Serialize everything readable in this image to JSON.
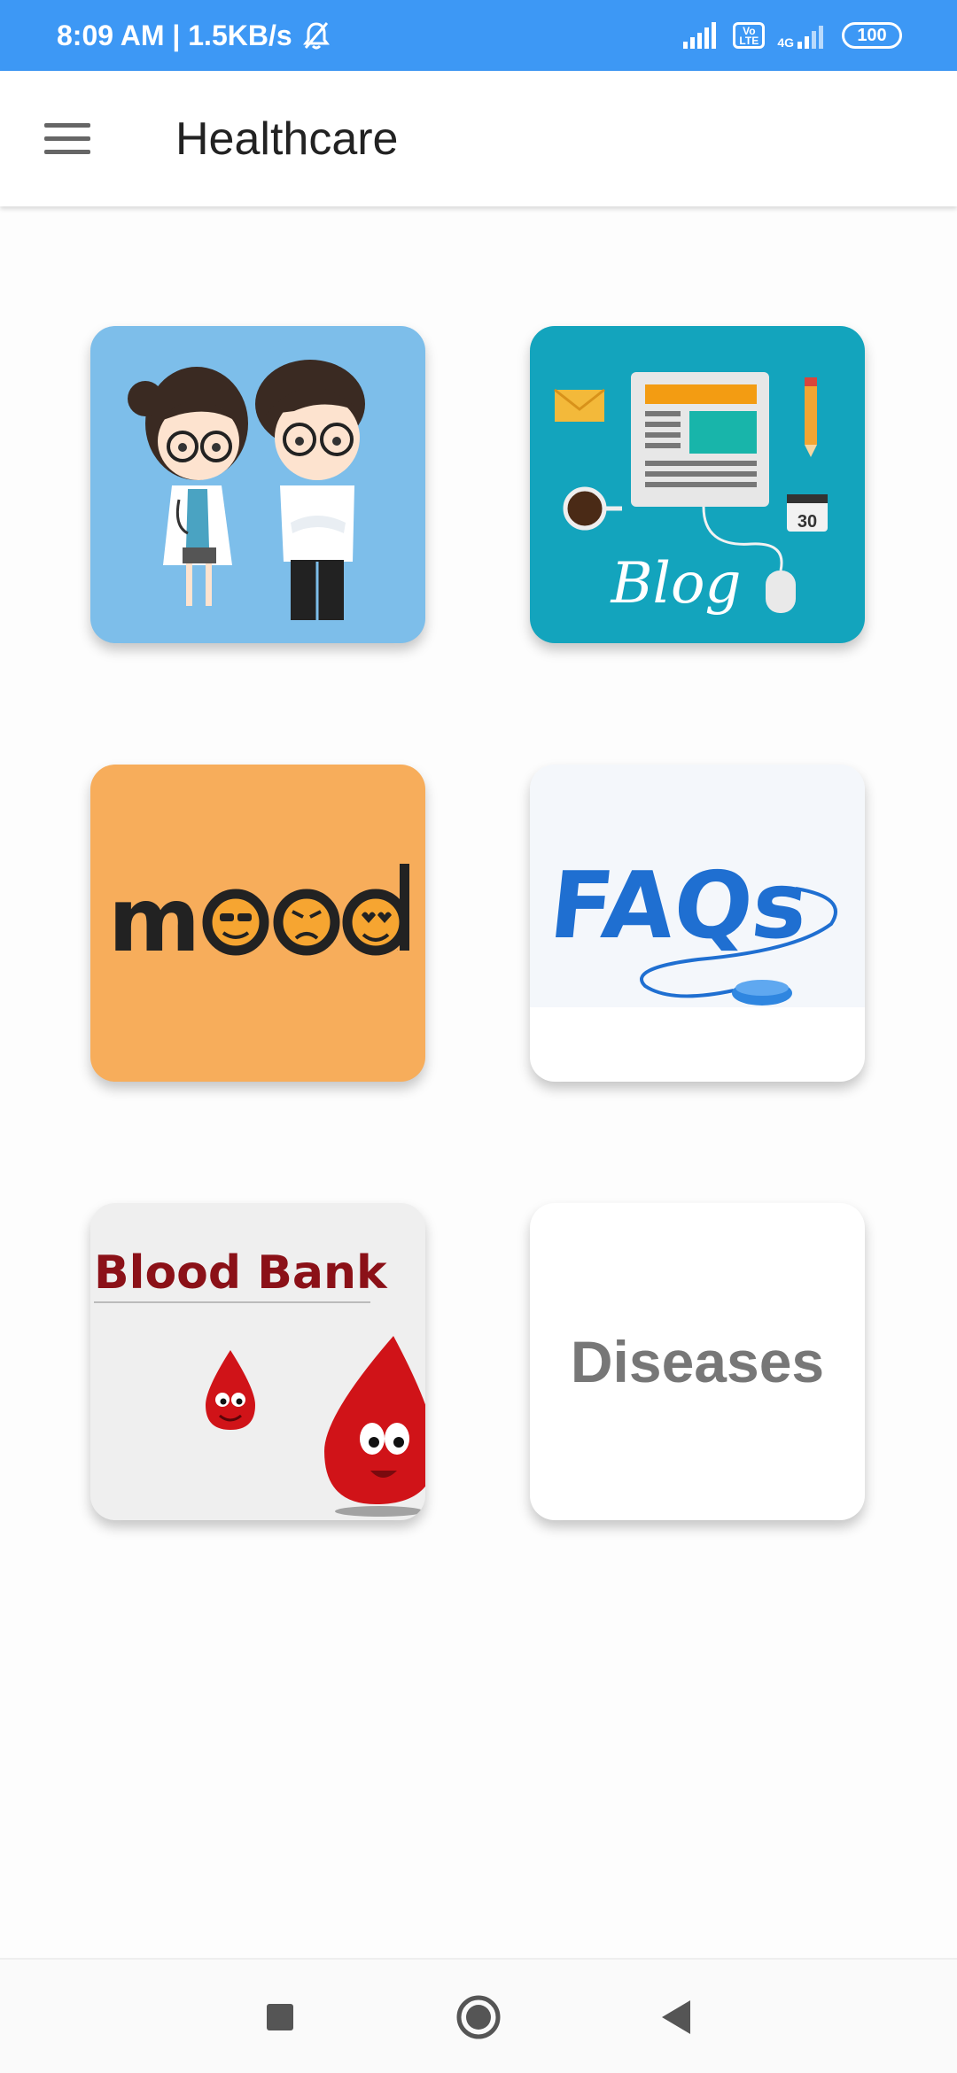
{
  "status_bar": {
    "time_text": "8:09 AM | 1.5KB/s",
    "volte_label": "Vo\nLTE",
    "network_label": "4G",
    "battery_level": "100"
  },
  "app_bar": {
    "title": "Healthcare",
    "menu_icon": "hamburger-menu-icon"
  },
  "tiles": [
    {
      "id": "doctors",
      "image": "doctor-couple-illustration",
      "bg": "#7dbeea"
    },
    {
      "id": "blog",
      "image_text": "Blog",
      "date_number": "30",
      "bg": "#13a4bd"
    },
    {
      "id": "mood",
      "image_text": "m",
      "image_text_2": "d",
      "bg": "#f7ad5b"
    },
    {
      "id": "faqs",
      "image_text": "FAQs",
      "bg": "#ffffff"
    },
    {
      "id": "blood_bank",
      "image_text": "Blood Bank",
      "bg": "#efefef"
    },
    {
      "id": "diseases",
      "label": "Diseases",
      "bg": "#ffffff"
    }
  ],
  "nav_bar": {
    "recents_icon": "square-recents-icon",
    "home_icon": "circle-home-icon",
    "back_icon": "triangle-back-icon"
  },
  "colors": {
    "status_bar": "#3d98f5",
    "mood_orange": "#f7ad5b",
    "blog_teal": "#13a4bd",
    "faq_blue": "#1f6fd1",
    "blood_red": "#8b1118"
  }
}
